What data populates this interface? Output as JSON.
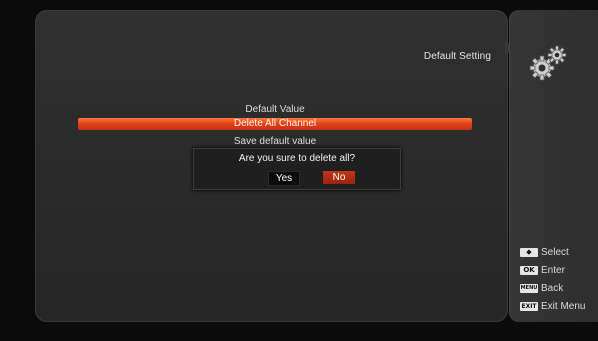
{
  "header": {
    "title": "Default Setting",
    "icon": "gear-icon"
  },
  "menu": {
    "items": [
      {
        "label": "Default Value",
        "selected": false
      },
      {
        "label": "Delete All Channel",
        "selected": true
      },
      {
        "label": "Save default value",
        "selected": false
      }
    ]
  },
  "dialog": {
    "question": "Are you sure to delete all?",
    "yes_label": "Yes",
    "no_label": "No",
    "focused": "No"
  },
  "hints": [
    {
      "key": "◆",
      "key_icon": "up-down-arrow-icon",
      "label": "Select"
    },
    {
      "key": "OK",
      "key_icon": "ok-key-icon",
      "label": "Enter"
    },
    {
      "key": "MENU",
      "key_icon": "menu-key-icon",
      "label": "Back"
    },
    {
      "key": "EXIT",
      "key_icon": "exit-key-icon",
      "label": "Exit Menu"
    }
  ],
  "colors": {
    "highlight": "#e2431b",
    "no_button": "#b02e14",
    "panel": "#2c2c2c"
  }
}
